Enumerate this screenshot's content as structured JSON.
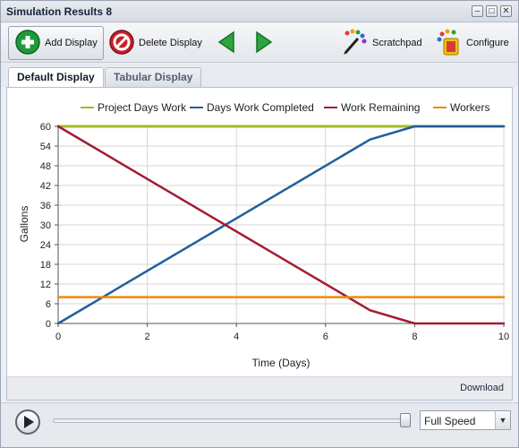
{
  "window": {
    "title": "Simulation Results 8",
    "controls": {
      "minimize": "–",
      "maximize": "□",
      "close": "✕"
    }
  },
  "toolbar": {
    "add_display_label": "Add Display",
    "delete_display_label": "Delete Display",
    "scratchpad_label": "Scratchpad",
    "configure_label": "Configure",
    "back_icon": "green-left-arrow-icon",
    "forward_icon": "green-right-arrow-icon"
  },
  "tabs": [
    {
      "label": "Default Display",
      "active": true
    },
    {
      "label": "Tabular Display",
      "active": false
    }
  ],
  "panel": {
    "download_label": "Download"
  },
  "playback": {
    "play_icon": "play-icon",
    "speed_label": "Full Speed",
    "slider_position": 1.0
  },
  "colors": {
    "project_days_work": "#9dbd2b",
    "days_work_completed": "#1f5f9d",
    "work_remaining": "#a31b32",
    "workers": "#f08a00"
  },
  "chart_data": {
    "type": "line",
    "title": "",
    "xlabel": "Time (Days)",
    "ylabel": "Gallons",
    "xlim": [
      0,
      10
    ],
    "ylim": [
      0,
      60
    ],
    "xticks": [
      0,
      2,
      4,
      6,
      8,
      10
    ],
    "yticks": [
      0,
      6,
      12,
      18,
      24,
      30,
      36,
      42,
      48,
      54,
      60
    ],
    "grid": true,
    "legend_position": "top",
    "series": [
      {
        "name": "Project Days Work",
        "color": "#9dbd2b",
        "x": [
          0,
          10
        ],
        "y": [
          60,
          60
        ]
      },
      {
        "name": "Days Work Completed",
        "color": "#1f5f9d",
        "x": [
          0,
          7,
          8,
          10
        ],
        "y": [
          0,
          56,
          60,
          60
        ]
      },
      {
        "name": "Work Remaining",
        "color": "#a31b32",
        "x": [
          0,
          7,
          8,
          10
        ],
        "y": [
          60,
          4,
          0,
          0
        ]
      },
      {
        "name": "Workers",
        "color": "#f08a00",
        "x": [
          0,
          10
        ],
        "y": [
          8,
          8
        ]
      }
    ]
  }
}
